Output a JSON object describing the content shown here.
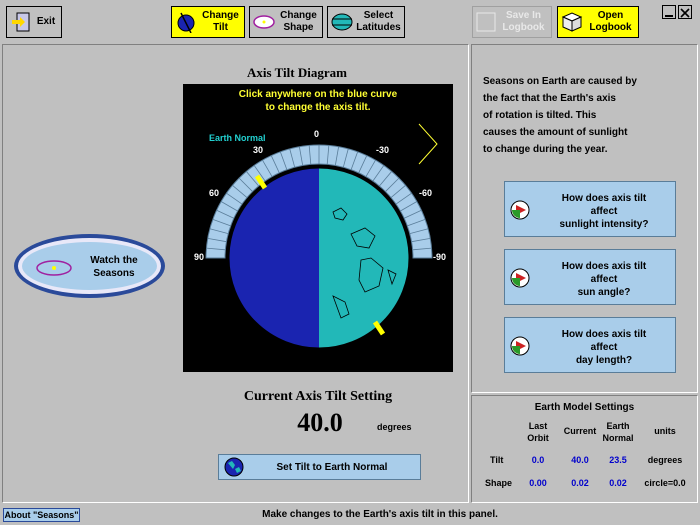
{
  "toolbar": {
    "exit": "Exit",
    "change_tilt": "Change\nTilt",
    "change_shape": "Change\nShape",
    "select_latitudes": "Select\nLatitudes",
    "save_logbook": "Save In\nLogbook",
    "open_logbook": "Open\nLogbook"
  },
  "diagram": {
    "title": "Axis Tilt Diagram",
    "instruction_1": "Click anywhere on the blue curve",
    "instruction_2": "to change the axis tilt.",
    "earth_normal_label": "Earth Normal",
    "ticks": [
      "0",
      "30",
      "-30",
      "60",
      "-60",
      "90",
      "-90"
    ]
  },
  "watch_seasons": "Watch the\nSeasons",
  "setting": {
    "title": "Current Axis Tilt Setting",
    "value": "40.0",
    "unit": "degrees",
    "reset_button": "Set Tilt to Earth Normal"
  },
  "info_text": "Seasons on Earth are caused by\nthe fact that the Earth's axis\nof rotation is tilted.  This\ncauses the amount of sunlight\nto change during the year.",
  "questions": [
    "How does axis tilt\naffect\nsunlight intensity?",
    "How does axis tilt\naffect\nsun angle?",
    "How does axis tilt\naffect\nday length?"
  ],
  "model_settings": {
    "title": "Earth Model Settings",
    "headers": [
      "Last\nOrbit",
      "Current",
      "Earth\nNormal",
      "units"
    ],
    "rows": [
      {
        "label": "Tilt",
        "last": "0.0",
        "current": "40.0",
        "normal": "23.5",
        "units": "degrees"
      },
      {
        "label": "Shape",
        "last": "0.00",
        "current": "0.02",
        "normal": "0.02",
        "units": "circle=0.0"
      }
    ]
  },
  "footer": {
    "about": "About \"Seasons\"",
    "status": "Make changes to the Earth's axis tilt in this panel."
  },
  "colors": {
    "earth_day": "#22b8b8",
    "earth_night": "#1a24b0",
    "scale_blue": "#a9cdea",
    "button_yellow": "#ffff00",
    "instruction_yellow": "#ffff33"
  }
}
